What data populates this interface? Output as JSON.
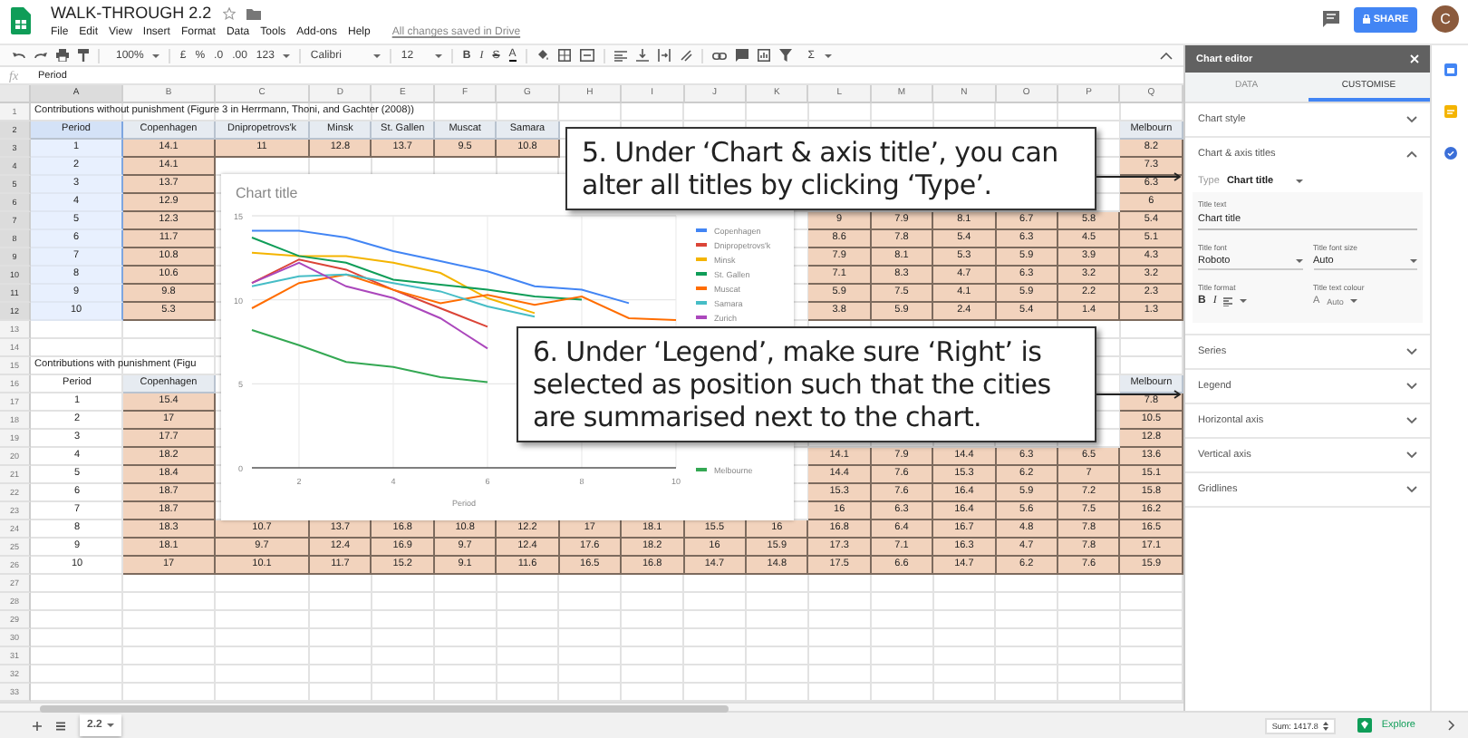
{
  "header": {
    "title": "WALK-THROUGH 2.2",
    "menu": [
      "File",
      "Edit",
      "View",
      "Insert",
      "Format",
      "Data",
      "Tools",
      "Add-ons",
      "Help"
    ],
    "save_status": "All changes saved in Drive",
    "share": "SHARE",
    "avatar_letter": "C"
  },
  "toolbar": {
    "zoom": "100%",
    "number_formats": [
      "£",
      "%",
      ".0",
      ".00",
      "123"
    ],
    "font": "Calibri",
    "font_size": "12",
    "text_styles": [
      "B",
      "I",
      "S",
      "A"
    ],
    "functions": "Σ"
  },
  "formula_bar": {
    "label": "fx",
    "value": "Period"
  },
  "sheet": {
    "columns": [
      {
        "letter": "A",
        "selected": true
      },
      {
        "letter": "B",
        "selected": false
      },
      {
        "letter": "C",
        "selected": false
      },
      {
        "letter": "D",
        "selected": false
      },
      {
        "letter": "E",
        "selected": false
      },
      {
        "letter": "F",
        "selected": false
      },
      {
        "letter": "G",
        "selected": false
      },
      {
        "letter": "H",
        "selected": false
      },
      {
        "letter": "I",
        "selected": false
      },
      {
        "letter": "J",
        "selected": false
      },
      {
        "letter": "K",
        "selected": false
      },
      {
        "letter": "L",
        "selected": false
      },
      {
        "letter": "M",
        "selected": false
      },
      {
        "letter": "N",
        "selected": false
      },
      {
        "letter": "O",
        "selected": false
      },
      {
        "letter": "P",
        "selected": false
      },
      {
        "letter": "Q",
        "selected": false
      }
    ],
    "rows": [
      {
        "number": "1",
        "kind": "title",
        "selected": false,
        "cells": [
          "Contributions without punishment (Figure 3 in Herrmann, Thoni, and Gachter (2008))"
        ]
      },
      {
        "number": "2",
        "kind": "header",
        "selected": true,
        "cells": [
          "Period",
          "Copenhagen",
          "Dnipropetrovs'k",
          "Minsk",
          "St. Gallen",
          "Muscat",
          "Samara",
          null,
          null,
          null,
          null,
          null,
          null,
          null,
          null,
          null,
          "Melbourn"
        ]
      },
      {
        "number": "3",
        "kind": "data",
        "selected": true,
        "cells": [
          "1",
          "14.1",
          "11",
          "12.8",
          "13.7",
          "9.5",
          "10.8",
          null,
          null,
          null,
          null,
          null,
          null,
          null,
          null,
          null,
          "8.2"
        ]
      },
      {
        "number": "4",
        "kind": "data",
        "selected": true,
        "cells": [
          "2",
          "14.1",
          null,
          null,
          null,
          null,
          null,
          null,
          null,
          null,
          null,
          null,
          null,
          null,
          null,
          null,
          "7.3"
        ]
      },
      {
        "number": "5",
        "kind": "data",
        "selected": true,
        "cells": [
          "3",
          "13.7",
          null,
          null,
          null,
          null,
          null,
          null,
          null,
          null,
          null,
          null,
          null,
          null,
          null,
          null,
          "6.3"
        ]
      },
      {
        "number": "6",
        "kind": "data",
        "selected": true,
        "cells": [
          "4",
          "12.9",
          null,
          null,
          null,
          null,
          null,
          null,
          null,
          null,
          null,
          null,
          null,
          null,
          null,
          null,
          "6"
        ]
      },
      {
        "number": "7",
        "kind": "data",
        "selected": true,
        "cells": [
          "5",
          "12.3",
          null,
          null,
          null,
          null,
          null,
          null,
          null,
          null,
          null,
          "9",
          "7.9",
          "8.1",
          "6.7",
          "5.8",
          "5.4"
        ]
      },
      {
        "number": "8",
        "kind": "data",
        "selected": true,
        "cells": [
          "6",
          "11.7",
          null,
          null,
          null,
          null,
          null,
          null,
          null,
          null,
          null,
          "8.6",
          "7.8",
          "5.4",
          "6.3",
          "4.5",
          "5.1"
        ]
      },
      {
        "number": "9",
        "kind": "data",
        "selected": true,
        "cells": [
          "7",
          "10.8",
          null,
          null,
          null,
          null,
          null,
          null,
          null,
          null,
          null,
          "7.9",
          "8.1",
          "5.3",
          "5.9",
          "3.9",
          "4.3"
        ]
      },
      {
        "number": "10",
        "kind": "data",
        "selected": true,
        "cells": [
          "8",
          "10.6",
          null,
          null,
          null,
          null,
          null,
          null,
          null,
          null,
          null,
          "7.1",
          "8.3",
          "4.7",
          "6.3",
          "3.2",
          "3.2"
        ]
      },
      {
        "number": "11",
        "kind": "data",
        "selected": true,
        "cells": [
          "9",
          "9.8",
          null,
          null,
          null,
          null,
          null,
          null,
          null,
          null,
          null,
          "5.9",
          "7.5",
          "4.1",
          "5.9",
          "2.2",
          "2.3"
        ]
      },
      {
        "number": "12",
        "kind": "data",
        "selected": true,
        "cells": [
          "10",
          "5.3",
          null,
          null,
          null,
          null,
          null,
          null,
          null,
          null,
          null,
          "3.8",
          "5.9",
          "2.4",
          "5.4",
          "1.4",
          "1.3"
        ]
      },
      {
        "number": "13",
        "kind": "blank",
        "selected": false
      },
      {
        "number": "14",
        "kind": "blank",
        "selected": false
      },
      {
        "number": "15",
        "kind": "title",
        "selected": false,
        "cells": [
          "Contributions with punishment (Figu"
        ]
      },
      {
        "number": "16",
        "kind": "header",
        "selected": false,
        "cells": [
          "Period",
          "Copenhagen",
          null,
          null,
          null,
          null,
          null,
          null,
          null,
          null,
          null,
          null,
          null,
          null,
          null,
          null,
          "Melbourn"
        ]
      },
      {
        "number": "17",
        "kind": "data",
        "selected": false,
        "cells": [
          "1",
          "15.4",
          null,
          null,
          null,
          null,
          null,
          null,
          null,
          null,
          null,
          null,
          null,
          null,
          null,
          null,
          "7.8"
        ]
      },
      {
        "number": "18",
        "kind": "data",
        "selected": false,
        "cells": [
          "2",
          "17",
          null,
          null,
          null,
          null,
          null,
          null,
          null,
          null,
          null,
          null,
          null,
          null,
          null,
          null,
          "10.5"
        ]
      },
      {
        "number": "19",
        "kind": "data",
        "selected": false,
        "cells": [
          "3",
          "17.7",
          null,
          null,
          null,
          null,
          null,
          null,
          null,
          null,
          null,
          null,
          null,
          null,
          null,
          null,
          "12.8"
        ]
      },
      {
        "number": "20",
        "kind": "data",
        "selected": false,
        "cells": [
          "4",
          "18.2",
          null,
          null,
          null,
          null,
          null,
          null,
          null,
          null,
          null,
          "14.1",
          "7.9",
          "14.4",
          "6.3",
          "6.5",
          "13.6"
        ]
      },
      {
        "number": "21",
        "kind": "data",
        "selected": false,
        "cells": [
          "5",
          "18.4",
          null,
          null,
          null,
          null,
          null,
          null,
          null,
          null,
          null,
          "14.4",
          "7.6",
          "15.3",
          "6.2",
          "7",
          "15.1"
        ]
      },
      {
        "number": "22",
        "kind": "data",
        "selected": false,
        "cells": [
          "6",
          "18.7",
          null,
          null,
          null,
          null,
          null,
          null,
          null,
          null,
          null,
          "15.3",
          "7.6",
          "16.4",
          "5.9",
          "7.2",
          "15.8"
        ]
      },
      {
        "number": "23",
        "kind": "data",
        "selected": false,
        "cells": [
          "7",
          "18.7",
          null,
          null,
          null,
          null,
          null,
          null,
          null,
          null,
          null,
          "16",
          "6.3",
          "16.4",
          "5.6",
          "7.5",
          "16.2"
        ]
      },
      {
        "number": "24",
        "kind": "data",
        "selected": false,
        "cells": [
          "8",
          "18.3",
          "10.7",
          "13.7",
          "16.8",
          "10.8",
          "12.2",
          "17",
          "18.1",
          "15.5",
          "16",
          "16.8",
          "6.4",
          "16.7",
          "4.8",
          "7.8",
          "16.5"
        ]
      },
      {
        "number": "25",
        "kind": "data",
        "selected": false,
        "cells": [
          "9",
          "18.1",
          "9.7",
          "12.4",
          "16.9",
          "9.7",
          "12.4",
          "17.6",
          "18.2",
          "16",
          "15.9",
          "17.3",
          "7.1",
          "16.3",
          "4.7",
          "7.8",
          "17.1"
        ]
      },
      {
        "number": "26",
        "kind": "data",
        "selected": false,
        "cells": [
          "10",
          "17",
          "10.1",
          "11.7",
          "15.2",
          "9.1",
          "11.6",
          "16.5",
          "16.8",
          "14.7",
          "14.8",
          "17.5",
          "6.6",
          "14.7",
          "6.2",
          "7.6",
          "15.9"
        ]
      },
      {
        "number": "27",
        "kind": "blank",
        "selected": false
      },
      {
        "number": "28",
        "kind": "blank",
        "selected": false
      },
      {
        "number": "29",
        "kind": "blank",
        "selected": false
      },
      {
        "number": "30",
        "kind": "blank",
        "selected": false
      },
      {
        "number": "31",
        "kind": "blank",
        "selected": false
      },
      {
        "number": "32",
        "kind": "blank",
        "selected": false
      },
      {
        "number": "33",
        "kind": "blank",
        "selected": false
      }
    ]
  },
  "chart": {
    "chart_data": {
      "type": "line",
      "title": "Chart title",
      "xlabel": "Period",
      "x": [
        1,
        2,
        3,
        4,
        5,
        6,
        7,
        8,
        9,
        10
      ],
      "xlim": [
        1,
        10
      ],
      "ylim": [
        0,
        15
      ],
      "xticks": [
        2,
        4,
        6,
        8,
        10
      ],
      "yticks": [
        0,
        5,
        10,
        15
      ],
      "grid": true,
      "legend": true,
      "series": [
        {
          "name": "Copenhagen",
          "color": "#4285f4",
          "values": [
            14.1,
            14.1,
            13.7,
            12.9,
            12.3,
            11.7,
            10.8,
            10.6,
            9.8,
            null
          ]
        },
        {
          "name": "Dnipropetrovs'k",
          "color": "#db4437",
          "values": [
            11,
            12.4,
            11.8,
            10.6,
            9.5,
            8.4,
            null,
            null,
            null,
            null
          ]
        },
        {
          "name": "Minsk",
          "color": "#f4b400",
          "values": [
            12.8,
            12.6,
            12.6,
            12.2,
            11.6,
            10.1,
            9.2,
            null,
            null,
            null
          ]
        },
        {
          "name": "St. Gallen",
          "color": "#0f9d58",
          "values": [
            13.7,
            12.6,
            12.2,
            11.2,
            10.9,
            10.6,
            10.2,
            10,
            null,
            null
          ]
        },
        {
          "name": "Muscat",
          "color": "#ff6d00",
          "values": [
            9.5,
            11,
            11.5,
            10.6,
            9.8,
            10.3,
            9.7,
            10.2,
            8.9,
            8.8
          ]
        },
        {
          "name": "Samara",
          "color": "#46bdc6",
          "values": [
            10.8,
            11.4,
            11.5,
            11,
            10.5,
            9.6,
            9,
            null,
            null,
            null
          ]
        },
        {
          "name": "Zurich",
          "color": "#ab47bc",
          "values": [
            11,
            12.2,
            10.8,
            10.1,
            8.9,
            7.1,
            null,
            null,
            null,
            null
          ]
        },
        {
          "name": "Melbourne",
          "color": "#34a853",
          "values": [
            8.2,
            7.3,
            6.3,
            6,
            5.4,
            5.1,
            null,
            null,
            null,
            null
          ]
        }
      ]
    }
  },
  "callouts": [
    {
      "text": "5. Under ‘Chart & axis title’, you can alter all titles by clicking ‘Type’."
    },
    {
      "text": "6. Under ‘Legend’, make sure ‘Right’ is selected as position such that the cities are summarised next to the chart."
    }
  ],
  "chart_editor": {
    "title": "Chart editor",
    "tabs": [
      {
        "label": "DATA",
        "selected": false
      },
      {
        "label": "CUSTOMISE",
        "selected": true
      }
    ],
    "sections": [
      {
        "title": "Chart style",
        "expanded": false
      },
      {
        "title": "Chart & axis titles",
        "expanded": true,
        "body": {
          "type_label": "Type",
          "type_value": "Chart title",
          "text_label": "Title text",
          "text_value": "Chart title",
          "font_label": "Title font",
          "font_value": "Roboto",
          "size_label": "Title font size",
          "size_value": "Auto",
          "format_label": "Title format",
          "format_buttons": [
            "B",
            "I"
          ],
          "colour_label": "Title text colour",
          "colour_letter": "A",
          "colour_value": "Auto"
        }
      },
      {
        "title": "Series",
        "expanded": false
      },
      {
        "title": "Legend",
        "expanded": false
      },
      {
        "title": "Horizontal axis",
        "expanded": false
      },
      {
        "title": "Vertical axis",
        "expanded": false
      },
      {
        "title": "Gridlines",
        "expanded": false
      }
    ]
  },
  "bottom_bar": {
    "sheets": [
      {
        "name": "2.2",
        "selected": true
      }
    ],
    "sum": "Sum: 1417.8",
    "explore": "Explore"
  }
}
